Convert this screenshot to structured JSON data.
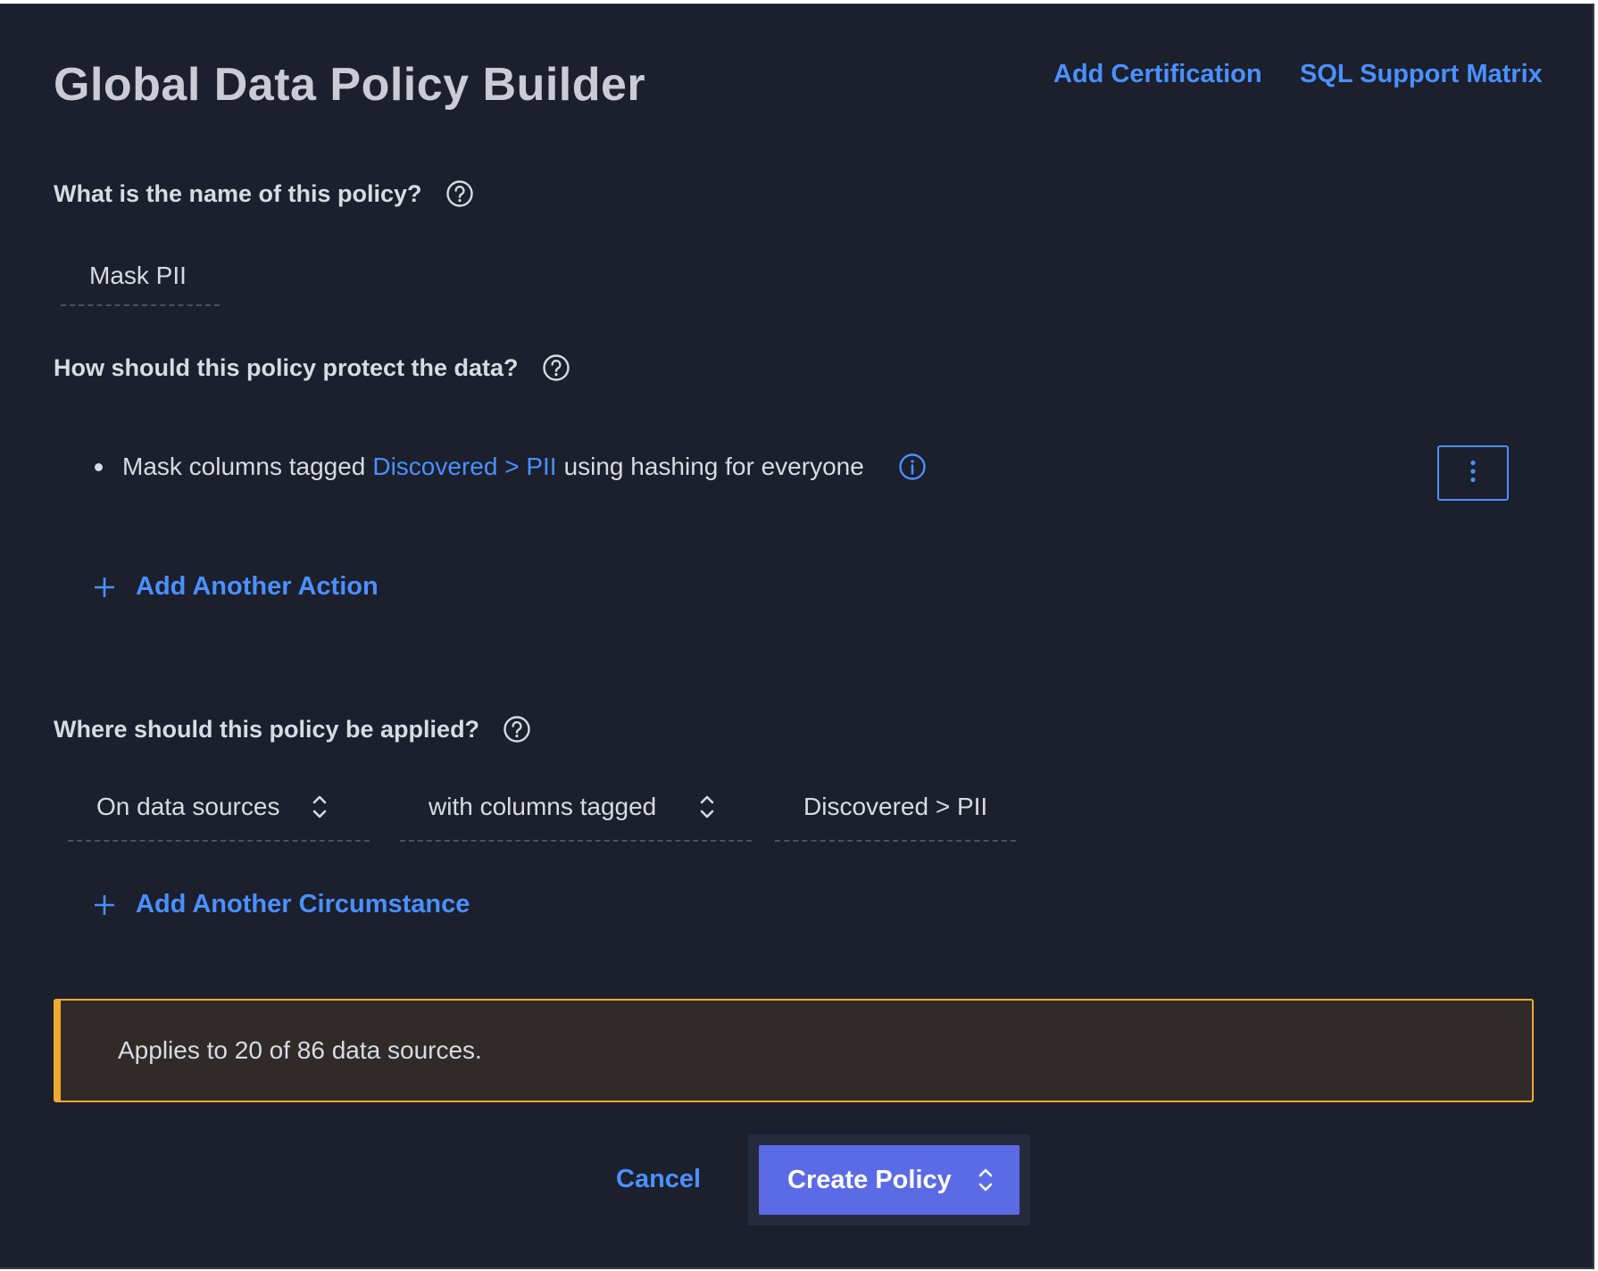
{
  "header": {
    "title": "Global Data Policy Builder",
    "links": [
      {
        "label": "Add Certification"
      },
      {
        "label": "SQL Support Matrix"
      }
    ]
  },
  "name_section": {
    "question": "What is the name of this policy?",
    "value": "Mask PII"
  },
  "protect_section": {
    "question": "How should this policy protect the data?",
    "action": {
      "prefix": "Mask columns tagged",
      "tag": "Discovered > PII",
      "suffix": "using hashing for everyone"
    },
    "add_action_label": "Add Another Action"
  },
  "apply_section": {
    "question": "Where should this policy be applied?",
    "scope_select": "On data sources",
    "condition_select": "with columns tagged",
    "tag_value": "Discovered > PII",
    "add_circumstance_label": "Add Another Circumstance"
  },
  "notice": {
    "text": "Applies to 20 of 86 data sources.",
    "accent_color": "#f0a930"
  },
  "footer": {
    "cancel_label": "Cancel",
    "create_label": "Create Policy"
  },
  "colors": {
    "background": "#1c1f2c",
    "link": "#4a90ff",
    "primary": "#5b6be6"
  },
  "icons": [
    "help-circle-icon",
    "info-circle-icon",
    "kebab-menu-icon",
    "plus-icon",
    "up-down-chevron-icon"
  ]
}
